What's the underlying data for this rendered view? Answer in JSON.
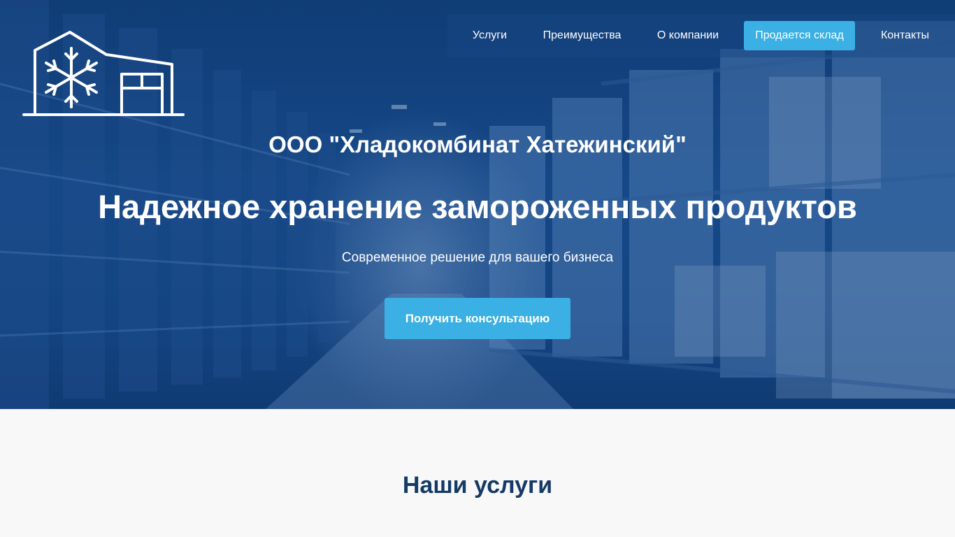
{
  "page": {
    "background_color": "#f8f8f8"
  },
  "header": {
    "logo_icon": "warehouse-snowflake-icon",
    "nav": [
      {
        "label": "Услуги"
      },
      {
        "label": "Преимущества"
      },
      {
        "label": "О компании"
      },
      {
        "label": "Продается склад",
        "active": true
      },
      {
        "label": "Контакты"
      }
    ]
  },
  "hero": {
    "company_name": "ООО \"Хладокомбинат Хатежинский\"",
    "title": "Надежное хранение замороженных продуктов",
    "subtitle": "Современное решение для вашего бизнеса",
    "cta_label": "Получить консультацию",
    "background": "warehouse-shelves-photo"
  },
  "services": {
    "title": "Наши услуги"
  },
  "colors": {
    "accent": "#3bb0e4",
    "hero_blue": "#1a4f8f",
    "heading_dark": "#143a66",
    "text_light": "#ffffff"
  }
}
